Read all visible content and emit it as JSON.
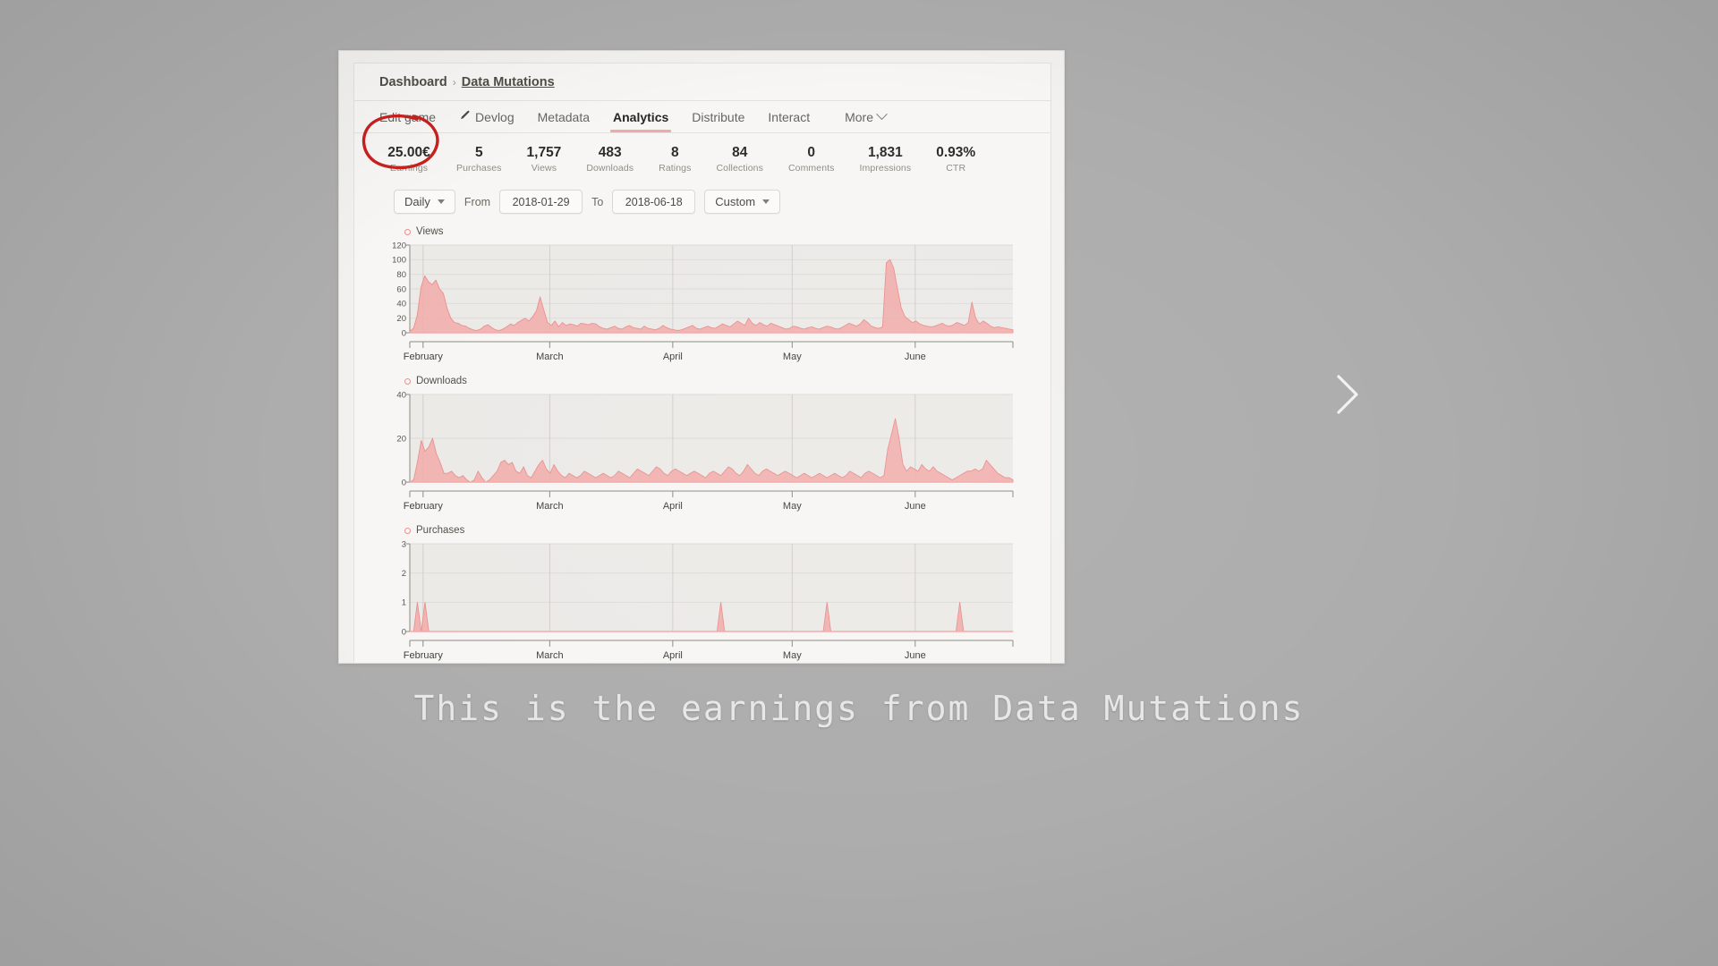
{
  "breadcrumb": {
    "root": "Dashboard",
    "separator": "›",
    "current": "Data Mutations"
  },
  "tabs": [
    {
      "label": "Edit game",
      "icon": null,
      "active": false
    },
    {
      "label": "Devlog",
      "icon": "pencil-icon",
      "active": false
    },
    {
      "label": "Metadata",
      "icon": null,
      "active": false
    },
    {
      "label": "Analytics",
      "icon": null,
      "active": true
    },
    {
      "label": "Distribute",
      "icon": null,
      "active": false
    },
    {
      "label": "Interact",
      "icon": null,
      "active": false
    },
    {
      "label": "More",
      "icon": "chevron-down-icon",
      "active": false
    }
  ],
  "stats": [
    {
      "value": "25.00€",
      "label": "Earnings"
    },
    {
      "value": "5",
      "label": "Purchases"
    },
    {
      "value": "1,757",
      "label": "Views"
    },
    {
      "value": "483",
      "label": "Downloads"
    },
    {
      "value": "8",
      "label": "Ratings"
    },
    {
      "value": "84",
      "label": "Collections"
    },
    {
      "value": "0",
      "label": "Comments"
    },
    {
      "value": "1,831",
      "label": "Impressions"
    },
    {
      "value": "0.93%",
      "label": "CTR"
    }
  ],
  "filters": {
    "granularity": "Daily",
    "from_label": "From",
    "from_value": "2018-01-29",
    "to_label": "To",
    "to_value": "2018-06-18",
    "range_preset": "Custom"
  },
  "annotation": {
    "circle_color": "#c8201f",
    "circle_target": "Earnings stat"
  },
  "caption": "This is the earnings from Data Mutations",
  "next_arrow": "chevron-right-icon",
  "colors": {
    "accent": "#e8908f",
    "area_fill": "#f2aaa8",
    "page_bg": "#f2f1ef",
    "card_bg": "#f7f6f4",
    "plot_bg": "#eceae7",
    "annotation_red": "#c8201f"
  },
  "chart_data": [
    {
      "type": "area",
      "title": "Views",
      "xlabel": "",
      "ylabel": "",
      "ylim": [
        0,
        120
      ],
      "yticks": [
        0,
        20,
        40,
        60,
        80,
        100,
        120
      ],
      "grid": true,
      "legend": [
        "Views"
      ],
      "legend_position": "top-left",
      "month_ticks": [
        "February",
        "March",
        "April",
        "May",
        "June"
      ],
      "x_range": [
        "2018-01-29",
        "2018-06-18"
      ],
      "values": [
        2,
        6,
        24,
        62,
        78,
        70,
        66,
        72,
        60,
        54,
        34,
        20,
        14,
        13,
        10,
        9,
        6,
        4,
        3,
        5,
        9,
        11,
        7,
        4,
        3,
        5,
        8,
        12,
        10,
        14,
        17,
        20,
        16,
        22,
        30,
        49,
        31,
        14,
        10,
        16,
        8,
        14,
        10,
        12,
        11,
        9,
        13,
        12,
        11,
        13,
        12,
        8,
        6,
        5,
        7,
        9,
        6,
        5,
        8,
        10,
        7,
        6,
        5,
        9,
        6,
        5,
        4,
        6,
        10,
        7,
        5,
        4,
        3,
        4,
        6,
        8,
        10,
        6,
        5,
        7,
        9,
        7,
        6,
        9,
        12,
        10,
        8,
        12,
        16,
        13,
        10,
        20,
        13,
        10,
        14,
        11,
        9,
        13,
        11,
        9,
        7,
        5,
        6,
        9,
        8,
        6,
        5,
        7,
        8,
        6,
        5,
        7,
        9,
        8,
        6,
        5,
        7,
        10,
        13,
        11,
        9,
        12,
        18,
        14,
        9,
        7,
        6,
        8,
        96,
        100,
        88,
        60,
        34,
        22,
        18,
        14,
        16,
        12,
        10,
        9,
        8,
        9,
        11,
        13,
        10,
        9,
        11,
        14,
        12,
        10,
        14,
        42,
        20,
        12,
        16,
        13,
        9,
        7,
        8,
        7,
        6,
        5,
        4
      ]
    },
    {
      "type": "area",
      "title": "Downloads",
      "xlabel": "",
      "ylabel": "",
      "ylim": [
        0,
        40
      ],
      "yticks": [
        0,
        20,
        40
      ],
      "grid": true,
      "legend": [
        "Downloads"
      ],
      "legend_position": "top-left",
      "month_ticks": [
        "February",
        "March",
        "April",
        "May",
        "June"
      ],
      "x_range": [
        "2018-01-29",
        "2018-06-18"
      ],
      "values": [
        0,
        1,
        9,
        19,
        14,
        16,
        20,
        13,
        9,
        4,
        4,
        5,
        3,
        2,
        3,
        1,
        0,
        1,
        5,
        2,
        0,
        1,
        3,
        5,
        9,
        10,
        8,
        9,
        5,
        4,
        7,
        3,
        2,
        5,
        8,
        10,
        6,
        4,
        8,
        5,
        3,
        2,
        4,
        3,
        2,
        3,
        5,
        4,
        3,
        2,
        3,
        4,
        3,
        2,
        3,
        5,
        4,
        3,
        2,
        4,
        6,
        5,
        4,
        3,
        5,
        7,
        6,
        4,
        3,
        5,
        6,
        5,
        4,
        3,
        4,
        5,
        4,
        3,
        2,
        4,
        5,
        4,
        3,
        5,
        7,
        6,
        4,
        3,
        5,
        8,
        6,
        4,
        3,
        5,
        6,
        5,
        4,
        3,
        4,
        5,
        4,
        3,
        2,
        3,
        4,
        3,
        2,
        3,
        4,
        3,
        2,
        3,
        4,
        3,
        2,
        3,
        5,
        4,
        3,
        2,
        4,
        5,
        4,
        3,
        2,
        3,
        15,
        22,
        29,
        20,
        8,
        5,
        7,
        6,
        5,
        8,
        6,
        5,
        7,
        5,
        4,
        3,
        2,
        1,
        2,
        3,
        4,
        5,
        5,
        6,
        5,
        6,
        10,
        8,
        6,
        4,
        3,
        2,
        2,
        1
      ]
    },
    {
      "type": "area",
      "title": "Purchases",
      "xlabel": "",
      "ylabel": "",
      "ylim": [
        0,
        3
      ],
      "yticks": [
        0,
        1,
        2,
        3
      ],
      "grid": true,
      "legend": [
        "Purchases"
      ],
      "legend_position": "top-left",
      "month_ticks": [
        "February",
        "March",
        "April",
        "May",
        "June"
      ],
      "x_range": [
        "2018-01-29",
        "2018-06-18"
      ],
      "values": [
        0,
        0,
        1,
        0,
        1,
        0,
        0,
        0,
        0,
        0,
        0,
        0,
        0,
        0,
        0,
        0,
        0,
        0,
        0,
        0,
        0,
        0,
        0,
        0,
        0,
        0,
        0,
        0,
        0,
        0,
        0,
        0,
        0,
        0,
        0,
        0,
        0,
        0,
        0,
        0,
        0,
        0,
        0,
        0,
        0,
        0,
        0,
        0,
        0,
        0,
        0,
        0,
        0,
        0,
        0,
        0,
        0,
        0,
        0,
        0,
        0,
        0,
        0,
        0,
        0,
        0,
        0,
        0,
        0,
        0,
        0,
        0,
        0,
        0,
        0,
        0,
        0,
        0,
        0,
        0,
        0,
        0,
        1,
        0,
        0,
        0,
        0,
        0,
        0,
        0,
        0,
        0,
        0,
        0,
        0,
        0,
        0,
        0,
        0,
        0,
        0,
        0,
        0,
        0,
        0,
        0,
        0,
        0,
        0,
        0,
        1,
        0,
        0,
        0,
        0,
        0,
        0,
        0,
        0,
        0,
        0,
        0,
        0,
        0,
        0,
        0,
        0,
        0,
        0,
        0,
        0,
        0,
        0,
        0,
        0,
        0,
        0,
        0,
        0,
        0,
        0,
        0,
        0,
        0,
        0,
        1,
        0,
        0,
        0,
        0,
        0,
        0,
        0,
        0,
        0,
        0,
        0,
        0,
        0,
        0
      ]
    }
  ]
}
